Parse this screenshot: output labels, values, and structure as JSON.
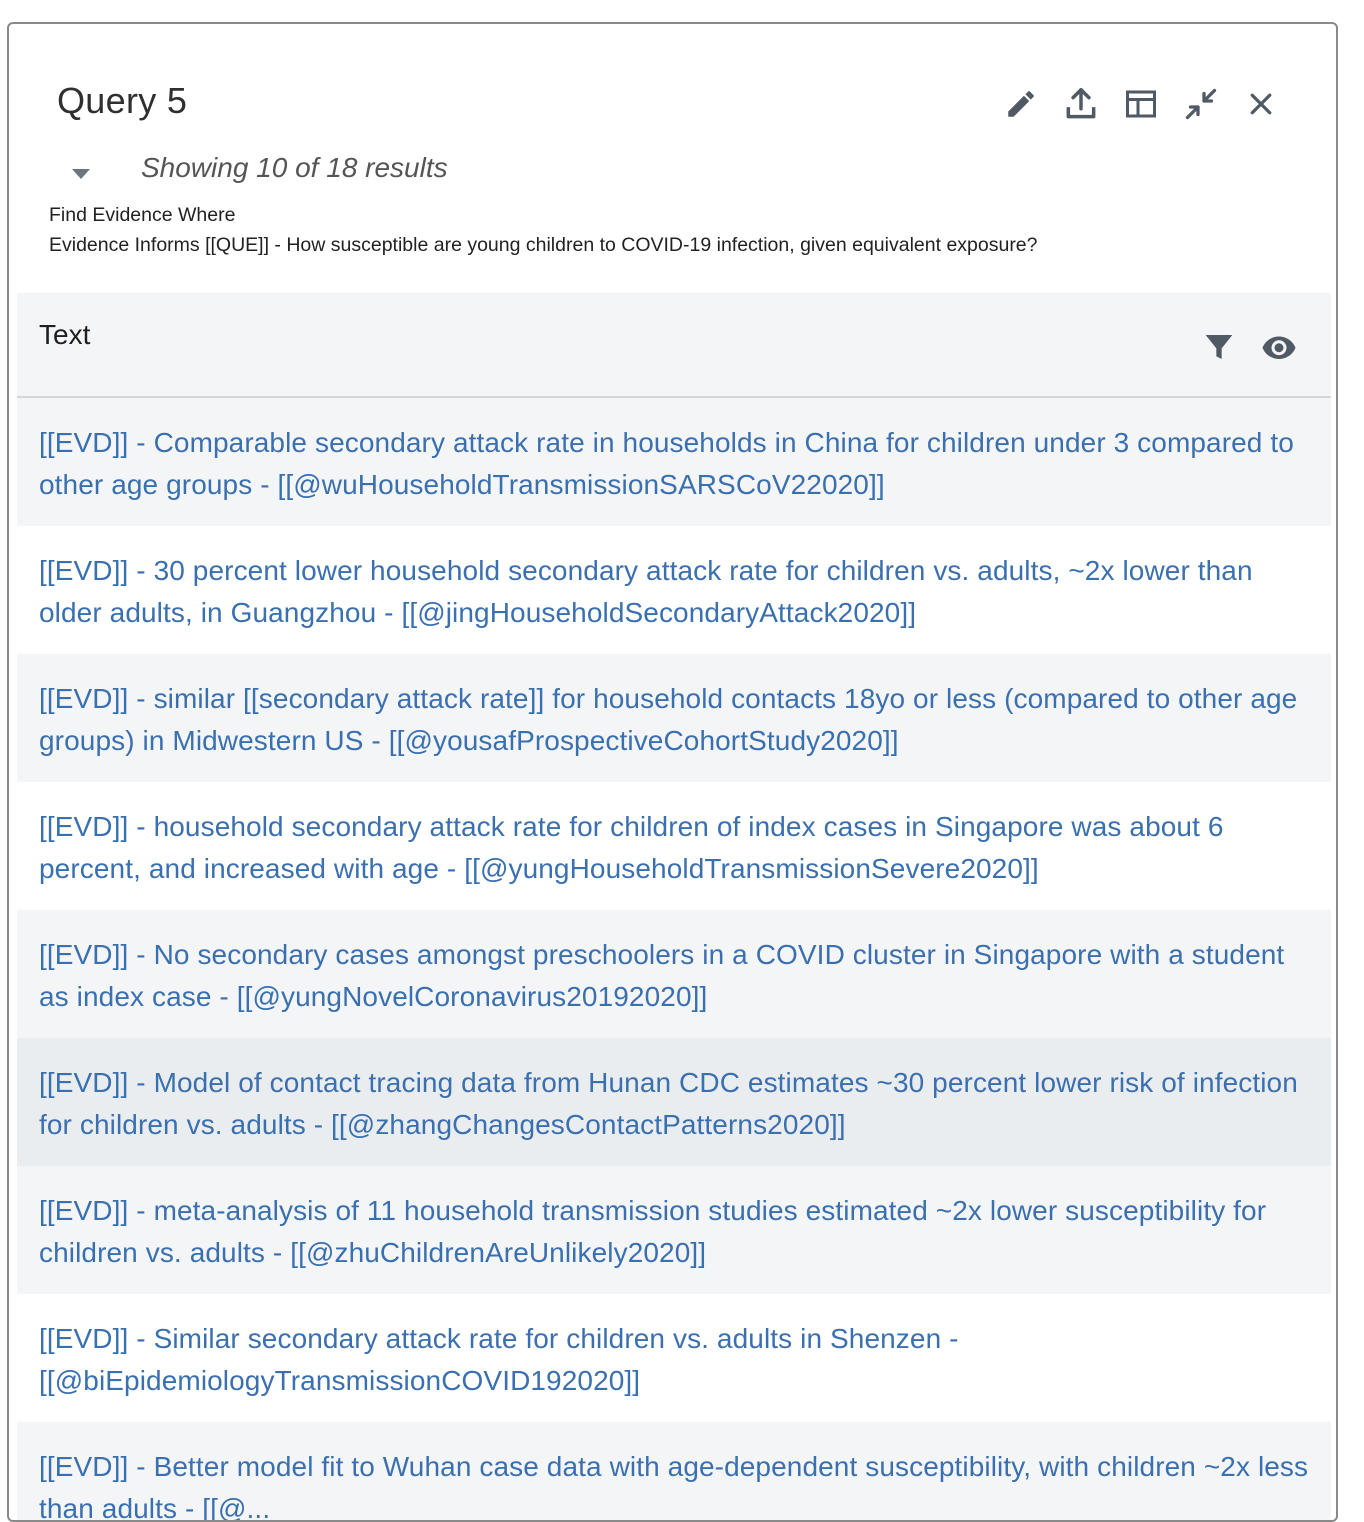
{
  "panel": {
    "title": "Query 5",
    "summary": "Showing 10 of 18 results",
    "query_lines": [
      "Find Evidence Where",
      "Evidence Informs [[QUE]] - How susceptible are young children to COVID-19 infection, given equivalent exposure?"
    ],
    "toolbar_icons": [
      "pencil-icon",
      "export-icon",
      "layout-icon",
      "collapse-icon",
      "close-icon"
    ]
  },
  "table": {
    "column_header": "Text",
    "header_icons": [
      "filter-icon",
      "eye-icon"
    ],
    "rows": [
      "[[EVD]] - Comparable secondary attack rate in households in China for children under 3 compared to other age groups - [[@wuHouseholdTransmissionSARSCoV22020]]",
      "[[EVD]] - 30 percent lower household secondary attack rate for children vs. adults, ~2x lower than older adults, in Guangzhou - [[@jingHouseholdSecondaryAttack2020]]",
      "[[EVD]] - similar [[secondary attack rate]] for household contacts 18yo or less (compared to other age groups) in Midwestern US - [[@yousafProspectiveCohortStudy2020]]",
      "[[EVD]] - household secondary attack rate for children of index cases in Singapore was about 6 percent, and increased with age - [[@yungHouseholdTransmissionSevere2020]]",
      "[[EVD]] - No secondary cases amongst preschoolers in a COVID cluster in Singapore with a student as index case - [[@yungNovelCoronavirus20192020]]",
      "[[EVD]] - Model of contact tracing data from Hunan CDC estimates ~30 percent lower risk of infection for children vs. adults - [[@zhangChangesContactPatterns2020]]",
      "[[EVD]] - meta-analysis of 11 household transmission studies estimated ~2x lower susceptibility for children vs. adults - [[@zhuChildrenAreUnlikely2020]]",
      "[[EVD]] - Similar secondary attack rate for children vs. adults in Shenzen - [[@biEpidemiologyTransmissionCOVID192020]]",
      "[[EVD]] - Better model fit to Wuhan case data with age-dependent susceptibility, with children ~2x less than adults - [[@..."
    ]
  },
  "colors": {
    "link": "#3a70b0",
    "header_bg": "#f4f5f6",
    "icon": "#505a65"
  }
}
